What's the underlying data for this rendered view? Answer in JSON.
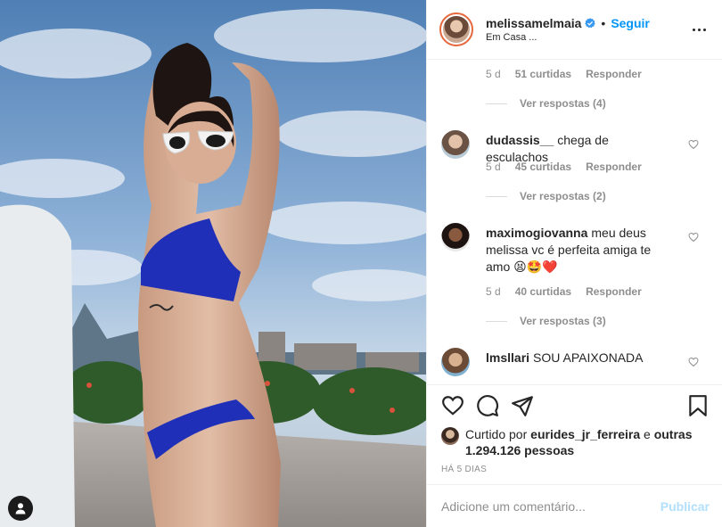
{
  "post": {
    "username": "melissamelmaia",
    "follow_label": "Seguir",
    "separator": "•",
    "location": "Em Casa ...",
    "verified_icon": "verified-badge-icon",
    "more_icon": "more-options-icon"
  },
  "comments": {
    "first_meta": {
      "time": "5 d",
      "likes": "51 curtidas",
      "reply": "Responder"
    },
    "first_replies": "Ver respostas (4)",
    "items": [
      {
        "user": "dudassis__",
        "text": "chega de esculachos",
        "time": "5 d",
        "likes": "45 curtidas",
        "reply": "Responder",
        "replies": "Ver respostas (2)"
      },
      {
        "user": "maximogiovanna",
        "text": "meu deus melissa vc é perfeita amiga te amo",
        "emoji": "😫🤩❤️",
        "time": "5 d",
        "likes": "40 curtidas",
        "reply": "Responder",
        "replies": "Ver respostas (3)"
      },
      {
        "user": "lmsllari",
        "text": "SOU APAIXONADA"
      }
    ]
  },
  "actions": {
    "like_icon": "heart-icon",
    "comment_icon": "comment-bubble-icon",
    "share_icon": "paper-plane-icon",
    "save_icon": "bookmark-icon"
  },
  "likes": {
    "prefix": "Curtido por",
    "user": "eurides_jr_ferreira",
    "conj": "e",
    "others": "outras 1.294.126 pessoas"
  },
  "timestamp": "HÁ 5 DIAS",
  "add_comment": {
    "placeholder": "Adicione um comentário...",
    "publish_label": "Publicar"
  },
  "colors": {
    "accent": "#0095f6",
    "publish_disabled": "#b2dffc",
    "muted": "#8e8e8e",
    "text": "#262626"
  }
}
